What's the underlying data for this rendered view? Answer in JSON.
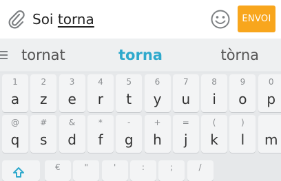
{
  "compose": {
    "text_prefix": "Soi ",
    "text_word": "torna",
    "send_label": "ENVOI",
    "icons": {
      "attach": "paperclip-icon",
      "emoji": "smiley-icon"
    }
  },
  "suggestions": {
    "left": "tornat",
    "center": "torna",
    "right": "tòrna",
    "accent_color": "#2ea9cc"
  },
  "keyboard": {
    "row1": [
      {
        "main": "a",
        "hint": "1"
      },
      {
        "main": "z",
        "hint": "2"
      },
      {
        "main": "e",
        "hint": "3"
      },
      {
        "main": "r",
        "hint": "4"
      },
      {
        "main": "t",
        "hint": "5"
      },
      {
        "main": "y",
        "hint": "6"
      },
      {
        "main": "u",
        "hint": "7"
      },
      {
        "main": "i",
        "hint": "8"
      },
      {
        "main": "o",
        "hint": "9"
      },
      {
        "main": "p",
        "hint": "0"
      }
    ],
    "row2": [
      {
        "main": "q",
        "hint": "@"
      },
      {
        "main": "s",
        "hint": "#"
      },
      {
        "main": "d",
        "hint": "&"
      },
      {
        "main": "f",
        "hint": "*"
      },
      {
        "main": "g",
        "hint": "-"
      },
      {
        "main": "h",
        "hint": "+"
      },
      {
        "main": "j",
        "hint": "="
      },
      {
        "main": "k",
        "hint": "("
      },
      {
        "main": "l",
        "hint": ")"
      },
      {
        "main": "m",
        "hint": ""
      }
    ],
    "row3_hints": [
      "€",
      "\"",
      "'",
      ":",
      ";",
      "/"
    ]
  },
  "colors": {
    "send_button": "#f8a61d",
    "background": "#e6e8ea"
  }
}
